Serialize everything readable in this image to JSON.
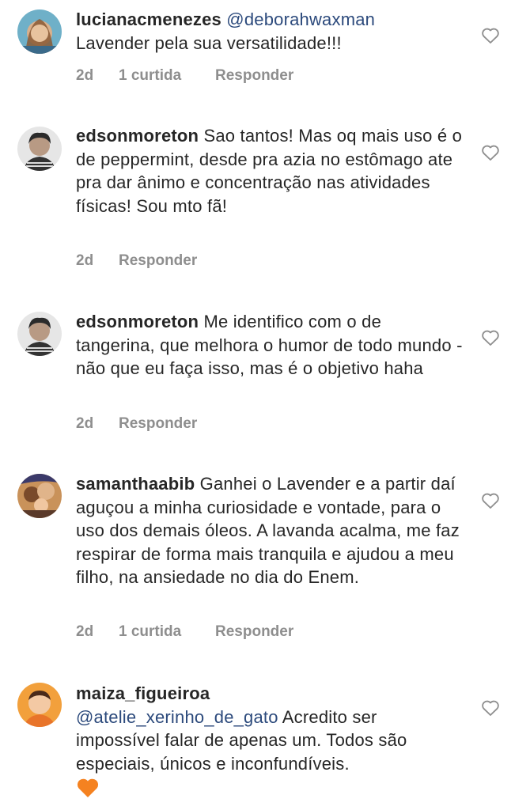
{
  "comments": [
    {
      "username": "lucianacmenezes",
      "mention": "@deborahwaxman",
      "text": "Lavender pela sua versatilidade!!!",
      "time": "2d",
      "likes": "1 curtida",
      "reply": "Responder"
    },
    {
      "username": "edsonmoreton",
      "text": "Sao tantos! Mas oq mais uso é o de peppermint, desde pra azia no estômago ate pra dar ânimo e concentração nas atividades físicas! Sou mto fã!",
      "time": "2d",
      "reply": "Responder"
    },
    {
      "username": "edsonmoreton",
      "text": "Me identifico com o de tangerina, que melhora o humor de todo mundo - não que eu faça isso, mas é o objetivo haha",
      "time": "2d",
      "reply": "Responder"
    },
    {
      "username": "samanthaabib",
      "text": "Ganhei o Lavender e a partir daí aguçou a minha curiosidade e vontade, para o uso dos demais óleos. A lavanda acalma, me faz respirar de forma mais tranquila e ajudou a meu filho, na ansiedade no dia do Enem.",
      "time": "2d",
      "likes": "1 curtida",
      "reply": "Responder"
    },
    {
      "username": "maiza_figueiroa",
      "mention": "@atelie_xerinho_de_gato",
      "text": "Acredito ser impossível falar de apenas um. Todos são especiais, únicos e inconfundíveis.",
      "emoji": "orange-heart"
    }
  ],
  "colors": {
    "text": "#262626",
    "meta": "#8e8e8e",
    "mention": "#2c4a7c",
    "orange_heart": "#f58220"
  },
  "icons": {
    "like": "heart-outline-icon"
  }
}
